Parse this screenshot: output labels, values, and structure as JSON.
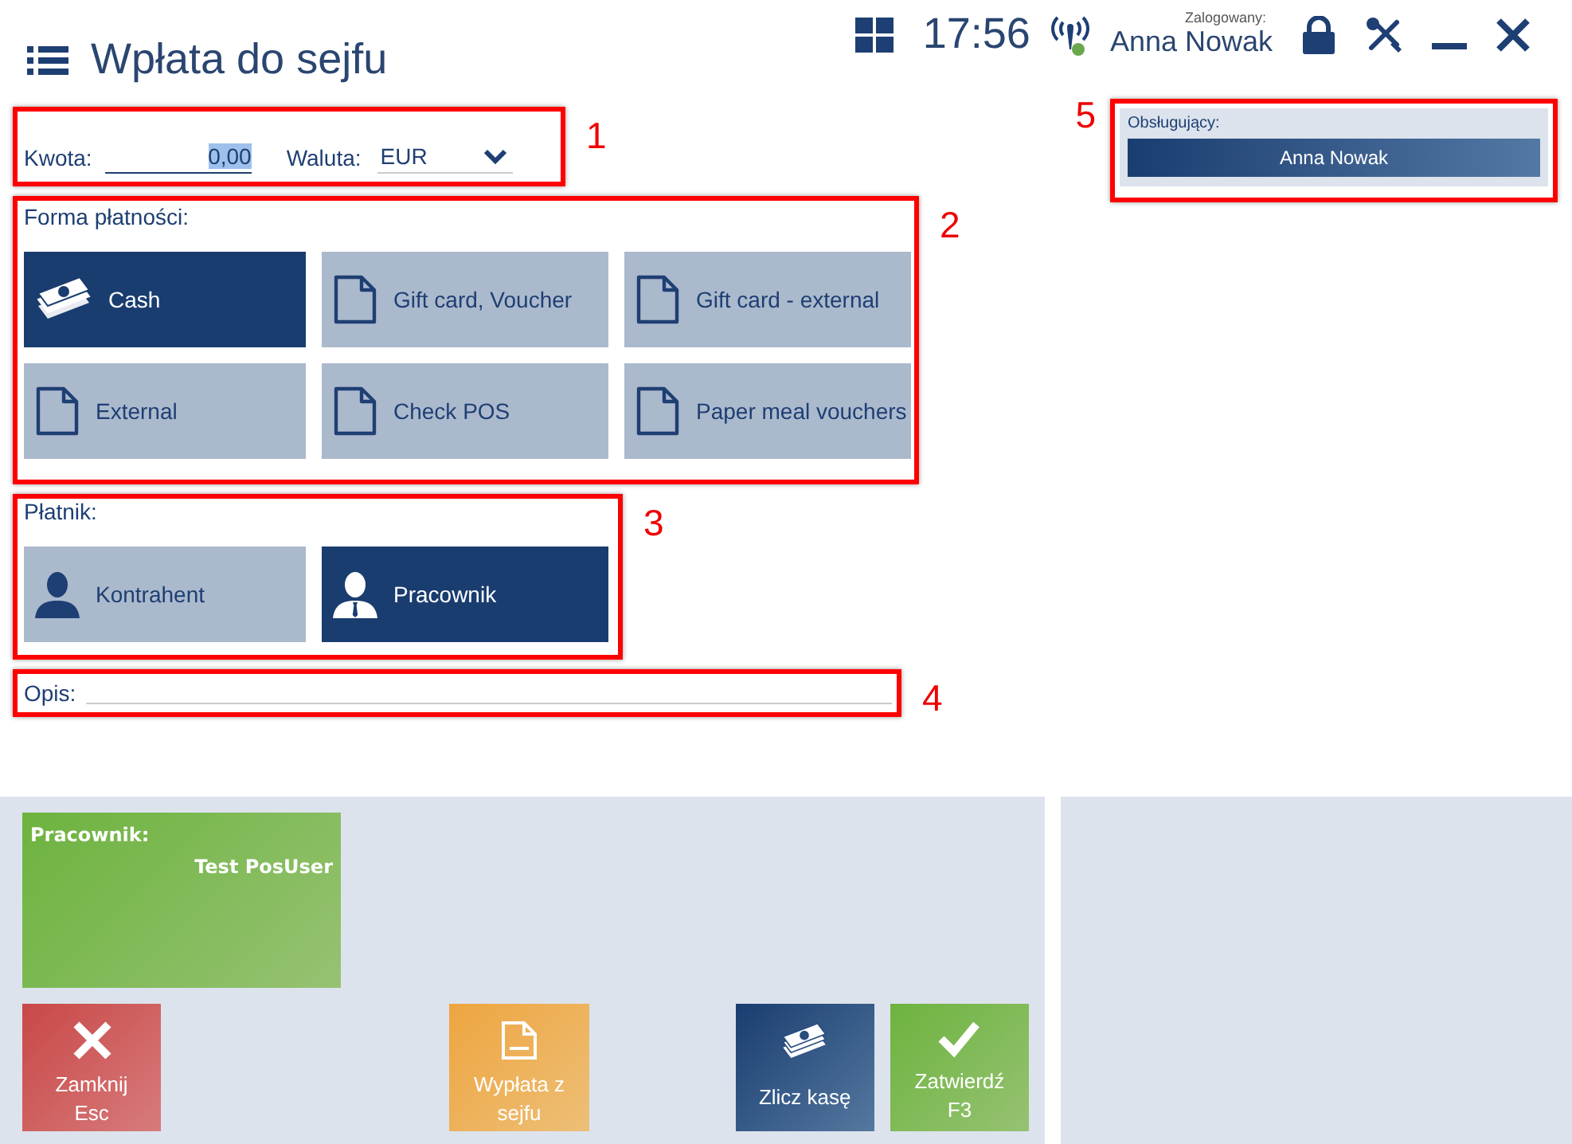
{
  "header": {
    "title": "Wpłata do sejfu",
    "time": "17:56",
    "logged_in_label": "Zalogowany:",
    "user": "Anna Nowak"
  },
  "amount": {
    "callout": "1",
    "label": "Kwota:",
    "value": "0,00",
    "currency_label": "Waluta:",
    "currency": "EUR"
  },
  "payment_form": {
    "callout": "2",
    "label": "Forma płatności:",
    "options": [
      {
        "label": "Cash",
        "kind": "cash",
        "selected": true
      },
      {
        "label": "Gift card, Voucher",
        "kind": "document",
        "selected": false
      },
      {
        "label": "Gift card - external",
        "kind": "document",
        "selected": false
      },
      {
        "label": "External",
        "kind": "document",
        "selected": false
      },
      {
        "label": "Check POS",
        "kind": "document",
        "selected": false
      },
      {
        "label": "Paper meal vouchers",
        "kind": "document",
        "selected": false
      }
    ]
  },
  "payer": {
    "callout": "3",
    "label": "Płatnik:",
    "options": [
      {
        "label": "Kontrahent",
        "kind": "person",
        "selected": false
      },
      {
        "label": "Pracownik",
        "kind": "employee",
        "selected": true
      }
    ]
  },
  "description": {
    "callout": "4",
    "label": "Opis:"
  },
  "operator": {
    "callout": "5",
    "label": "Obsługujący:",
    "name": "Anna Nowak"
  },
  "employee_card": {
    "label": "Pracownik:",
    "name": "Test PosUser"
  },
  "actions": [
    {
      "kind": "close",
      "label": "Zamknij",
      "shortcut": "Esc"
    },
    {
      "kind": "withdraw",
      "label": "Wypłata z sejfu"
    },
    {
      "kind": "count",
      "label": "Zlicz kasę"
    },
    {
      "kind": "confirm",
      "label": "Zatwierdź",
      "shortcut": "F3"
    }
  ]
}
